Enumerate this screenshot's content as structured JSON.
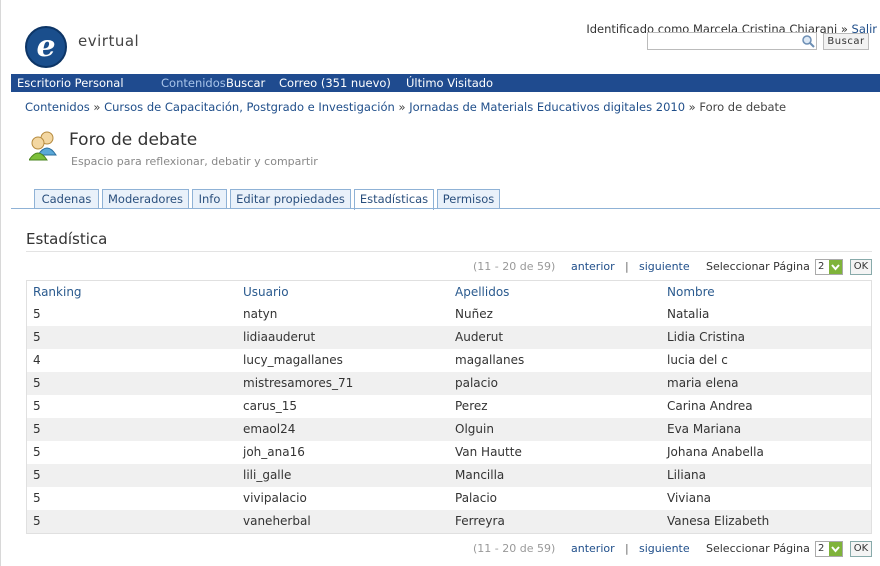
{
  "site": {
    "name": "evirtual",
    "logo_letter": "e"
  },
  "user": {
    "identified_prefix": "Identificado como Marcela Cristina Chiarani",
    "separator": " » ",
    "logout": "Salir"
  },
  "search": {
    "button": "Buscar",
    "placeholder": ""
  },
  "nav": {
    "items": [
      {
        "label": "Escritorio Personal"
      },
      {
        "label": "Contenidos"
      },
      {
        "label": "Buscar"
      },
      {
        "label": "Correo (351 nuevo)"
      },
      {
        "label": "Último Visitado"
      }
    ]
  },
  "breadcrumb": {
    "items": [
      "Contenidos",
      "Cursos de Capacitación, Postgrado e Investigación",
      "Jornadas de Materials Educativos digitales 2010",
      "Foro de debate"
    ],
    "separator": " » "
  },
  "page": {
    "title": "Foro de debate",
    "subtitle": "Espacio para reflexionar, debatir y compartir"
  },
  "tabs": [
    {
      "label": "Cadenas"
    },
    {
      "label": "Moderadores"
    },
    {
      "label": "Info"
    },
    {
      "label": "Editar propiedades"
    },
    {
      "label": "Estadísticas"
    },
    {
      "label": "Permisos"
    }
  ],
  "section": {
    "title": "Estadística"
  },
  "pager": {
    "range": "(11 - 20 de 59)",
    "prev": "anterior",
    "separator": "|",
    "next": "siguiente",
    "select_label": "Seleccionar Página",
    "selected_page": "2",
    "ok": "OK"
  },
  "table": {
    "headers": [
      "Ranking",
      "Usuario",
      "Apellidos",
      "Nombre"
    ],
    "rows": [
      [
        "5",
        "natyn",
        "Nuñez",
        "Natalia"
      ],
      [
        "5",
        "lidiaauderut",
        "Auderut",
        "Lidia Cristina"
      ],
      [
        "4",
        "lucy_magallanes",
        "magallanes",
        "lucia del c"
      ],
      [
        "5",
        "mistresamores_71",
        "palacio",
        "maria elena"
      ],
      [
        "5",
        "carus_15",
        "Perez",
        "Carina Andrea"
      ],
      [
        "5",
        "emaol24",
        "Olguin",
        "Eva Mariana"
      ],
      [
        "5",
        "joh_ana16",
        "Van Hautte",
        "Johana Anabella"
      ],
      [
        "5",
        "lili_galle",
        "Mancilla",
        "Liliana"
      ],
      [
        "5",
        "vivipalacio",
        "Palacio",
        "Viviana"
      ],
      [
        "5",
        "vaneherbal",
        "Ferreyra",
        "Vanesa Elizabeth"
      ]
    ]
  },
  "colors": {
    "nav_bg": "#1f4b8f",
    "link": "#1f4e8a",
    "tab_border": "#8fb2d6",
    "select_arrow": "#7fb33a"
  },
  "icons": {
    "search": "magnifier-icon",
    "forum": "users-forum-icon",
    "select_arrow": "chevron-down-icon"
  }
}
